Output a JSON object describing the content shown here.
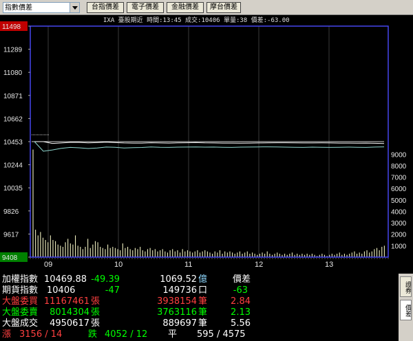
{
  "toolbar": {
    "selector_value": "指數價差",
    "buttons": [
      "台指價差",
      "電子價差",
      "金融價差",
      "摩台價差"
    ]
  },
  "chart_header": "IXA  臺股期近 時間:13:45 成交:10406 單量:38 價差:-63.00",
  "colors": {
    "price_high": "#c00000",
    "price_low": "#008000",
    "series_index": "#ffffff",
    "series_futures": "#8fd8d0",
    "volume": "#f0f0c0",
    "axis_border": "#4a4aff",
    "grid": "#3a3a3a"
  },
  "chart_data": {
    "type": "line",
    "y_left": {
      "ticks": [
        "11498",
        "11289",
        "11080",
        "10871",
        "10662",
        "10453",
        "10244",
        "10035",
        "9826",
        "9617",
        "9408"
      ],
      "range": [
        9408,
        11498
      ],
      "high_label": "11498",
      "low_label": "9408"
    },
    "y_right": {
      "ticks": [
        "9000",
        "8000",
        "7000",
        "6000",
        "5000",
        "4000",
        "3000",
        "2000",
        "1000"
      ],
      "range": [
        0,
        10000
      ]
    },
    "x_ticks": [
      "09",
      "10",
      "11",
      "12",
      "13"
    ],
    "reference_level": 10453,
    "series": [
      {
        "role": "index",
        "points": [
          10453,
          10453,
          10437,
          10441,
          10446,
          10446,
          10442,
          10444,
          10448,
          10444,
          10441,
          10440,
          10440,
          10443,
          10441,
          10440,
          10442,
          10443,
          10444,
          10442,
          10441,
          10440,
          10440,
          10439,
          10440,
          10441,
          10442,
          10443,
          10443,
          10442,
          10441,
          10441,
          10442,
          10441,
          10440,
          10440,
          10439,
          10440,
          10438,
          10436
        ]
      },
      {
        "role": "futures",
        "points": [
          10453,
          10366,
          10378,
          10392,
          10401,
          10397,
          10391,
          10395,
          10404,
          10402,
          10396,
          10398,
          10400,
          10405,
          10402,
          10401,
          10403,
          10404,
          10405,
          10403,
          10404,
          10402,
          10401,
          10403,
          10404,
          10405,
          10406,
          10405,
          10403,
          10402,
          10401,
          10403,
          10402,
          10401,
          10402,
          10403,
          10402,
          10401,
          10404,
          10406
        ]
      }
    ],
    "volume": [
      9408,
      2400,
      1900,
      2200,
      1700,
      1500,
      1300,
      1900,
      1500,
      1400,
      1100,
      1000,
      900,
      1300,
      1600,
      1200,
      1100,
      1900,
      1000,
      900,
      700,
      900,
      1600,
      800,
      1100,
      1400,
      1300,
      900,
      800,
      700,
      1100,
      800,
      900,
      800,
      700,
      600,
      1200,
      800,
      900,
      700,
      600,
      800,
      700,
      900,
      600,
      500,
      700,
      800,
      600,
      700,
      500,
      600,
      700,
      500,
      400,
      600,
      700,
      500,
      600,
      400,
      700,
      500,
      600,
      500,
      400,
      500,
      600,
      400,
      500,
      600,
      500,
      400,
      300,
      500,
      400,
      600,
      300,
      500,
      400,
      500,
      400,
      300,
      400,
      500,
      300,
      400,
      500,
      300,
      400,
      300,
      200,
      300,
      400,
      300,
      500,
      300,
      200,
      300,
      400,
      300,
      200,
      300,
      200,
      300,
      400,
      200,
      300,
      200,
      300,
      200,
      300,
      200,
      300,
      200,
      100,
      200,
      300,
      200,
      100,
      200,
      300,
      200,
      300,
      400,
      200,
      300,
      200,
      300,
      400,
      500,
      300,
      400,
      300,
      500,
      600,
      400,
      500,
      700,
      800,
      600,
      900,
      1000
    ]
  },
  "quotes": [
    {
      "label": "加權指數",
      "v1": "10469.88",
      "v2": "-49.39",
      "v3": "1069.52",
      "unit": "億",
      "extra": "價差",
      "c_label": "#ffffff",
      "c_v1": "#ffffff",
      "c_v2": "#00ff00",
      "c_v3": "#ffffff",
      "c_unit": "#8fd8ff",
      "c_extra": "#ffffff"
    },
    {
      "label": "期貨指數",
      "v1": "10406",
      "v2": "-47",
      "v3": "149736",
      "unit": "口",
      "extra": "-63",
      "c_label": "#ffffff",
      "c_v1": "#ffffff",
      "c_v2": "#00ff00",
      "c_v3": "#ffffff",
      "c_unit": "#ffffff",
      "c_extra": "#00ff00"
    },
    {
      "label": "大盤委買",
      "v1": "11167461",
      "unit1": "張",
      "v3": "3938154",
      "unit": "筆",
      "extra": "2.84",
      "c_label": "#ff4040",
      "c_v1": "#ff4040",
      "c_v3": "#ff4040",
      "c_unit": "#ff4040",
      "c_extra": "#ff4040"
    },
    {
      "label": "大盤委賣",
      "v1": "8014304",
      "unit1": "張",
      "v3": "3763116",
      "unit": "筆",
      "extra": "2.13",
      "c_label": "#00ff00",
      "c_v1": "#00ff00",
      "c_v3": "#00ff00",
      "c_unit": "#00ff00",
      "c_extra": "#00ff00"
    },
    {
      "label": "大盤成交",
      "v1": "4950617",
      "unit1": "張",
      "v3": "889697",
      "unit": "筆",
      "extra": "5.56",
      "c_label": "#ffffff",
      "c_v1": "#ffffff",
      "c_v3": "#ffffff",
      "c_unit": "#ffffff",
      "c_extra": "#ffffff"
    }
  ],
  "breadth": {
    "up_label": "漲",
    "up_value": "3156 / 14",
    "down_label": "跌",
    "down_value": "4052 / 12",
    "flat_label": "平",
    "flat_value": "595 / 4575"
  },
  "side_tabs": [
    "證券",
    "價差"
  ]
}
